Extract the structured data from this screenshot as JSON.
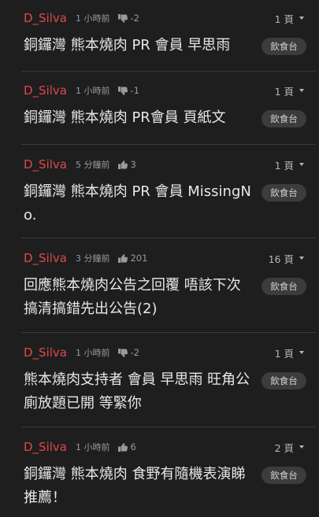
{
  "threads": [
    {
      "username": "D_Silva",
      "time": "1 小時前",
      "score": "-2",
      "vote": "down",
      "pages": "1 頁",
      "title": "銅鑼灣 熊本燒肉 PR 會員 早思雨",
      "category": "飲食台"
    },
    {
      "username": "D_Silva",
      "time": "1 小時前",
      "score": "-1",
      "vote": "down",
      "pages": "1 頁",
      "title": "銅鑼灣 熊本燒肉 PR會員 頁紙文",
      "category": "飲食台"
    },
    {
      "username": "D_Silva",
      "time": "5 分鐘前",
      "score": "3",
      "vote": "up",
      "pages": "1 頁",
      "title": "銅鑼灣 熊本燒肉 PR 會員 MissingNo.",
      "category": "飲食台"
    },
    {
      "username": "D_Silva",
      "time": "3 分鐘前",
      "score": "201",
      "vote": "up",
      "pages": "16 頁",
      "title": "回應熊本燒肉公告之回覆 唔該下次搞清搞錯先出公告(2)",
      "category": "飲食台"
    },
    {
      "username": "D_Silva",
      "time": "1 小時前",
      "score": "-2",
      "vote": "down",
      "pages": "1 頁",
      "title": "熊本燒肉支持者 會員 早思雨 旺角公廁放題已開 等緊你",
      "category": "飲食台"
    },
    {
      "username": "D_Silva",
      "time": "1 小時前",
      "score": "6",
      "vote": "up",
      "pages": "2 頁",
      "title": "銅鑼灣 熊本燒肉 食野有隨機表演睇 推薦！",
      "category": "飲食台"
    }
  ]
}
